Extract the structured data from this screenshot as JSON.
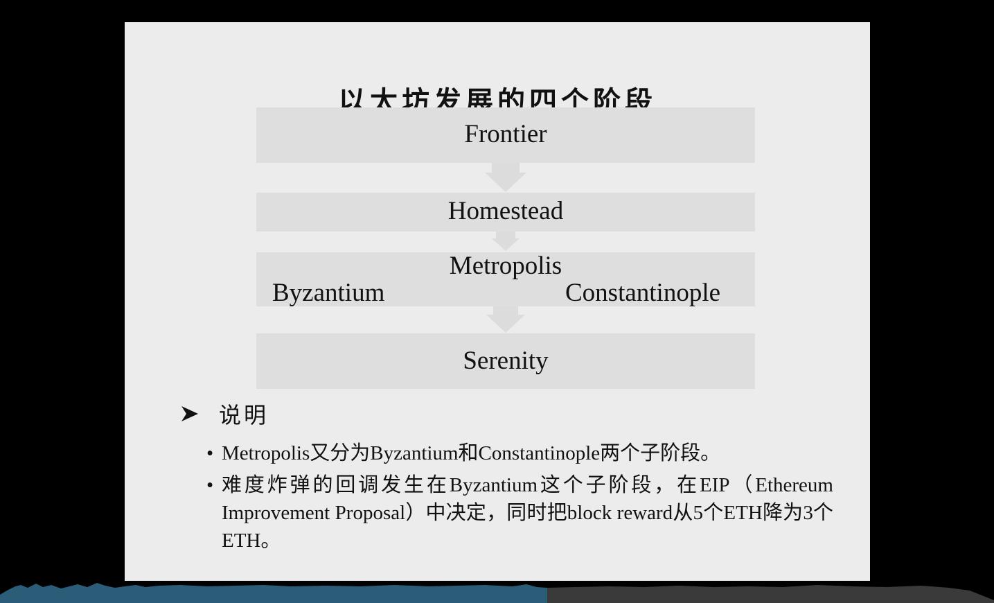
{
  "slide": {
    "title": "以太坊发展的四个阶段",
    "stages": {
      "frontier": "Frontier",
      "homestead": "Homestead",
      "metropolis": "Metropolis",
      "byzantium": "Byzantium",
      "constantinople": "Constantinople",
      "serenity": "Serenity"
    },
    "section_heading": "说明",
    "bullets": [
      "Metropolis又分为Byzantium和Constantinople两个子阶段。",
      "难度炸弹的回调发生在Byzantium这个子阶段，在EIP（Ethereum Improvement Proposal）中决定，同时把block reward从5个ETH降为3个ETH。"
    ],
    "bullet_symbol": "•"
  },
  "icons": {
    "section_bullet": "arrow-bullet-icon",
    "stage_connector": "down-arrow-icon"
  },
  "colors": {
    "background": "#000000",
    "slide": "#ececec",
    "stage_box": "#dedede",
    "text": "#111111",
    "waveform": "#2b5c78"
  }
}
